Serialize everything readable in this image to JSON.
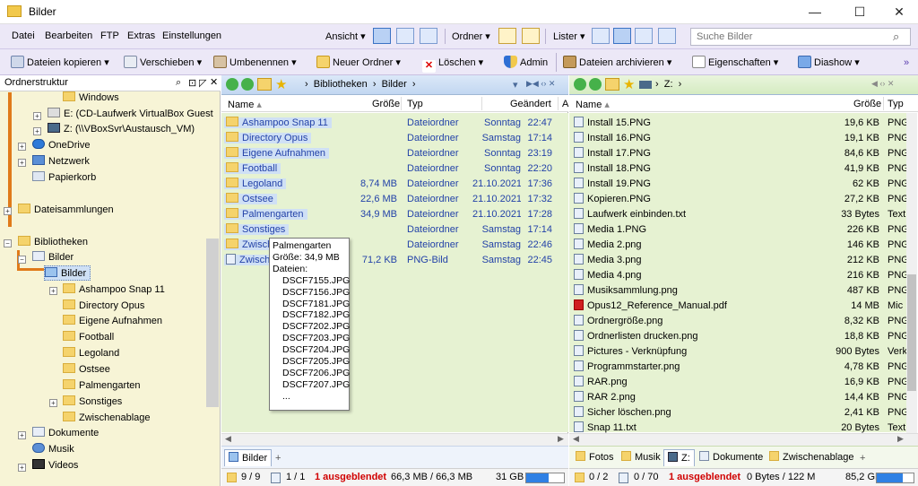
{
  "window": {
    "title": "Bilder",
    "min": "—",
    "max": "☐",
    "close": "✕"
  },
  "menu": [
    "Datei",
    "Bearbeiten",
    "FTP",
    "Extras",
    "Einstellungen"
  ],
  "menu_right": {
    "ansicht": "Ansicht",
    "ordner": "Ordner",
    "lister": "Lister"
  },
  "search": {
    "placeholder": "Suche Bilder"
  },
  "toolbar": {
    "copy": "Dateien kopieren",
    "move": "Verschieben",
    "rename": "Umbenennen",
    "newfolder": "Neuer Ordner",
    "delete": "Löschen",
    "admin": "Admin",
    "archive": "Dateien archivieren",
    "props": "Eigenschaften",
    "slideshow": "Diashow"
  },
  "tree": {
    "header": "Ordnerstruktur",
    "items": [
      {
        "label": "Windows"
      },
      {
        "label": "E: (CD-Laufwerk VirtualBox Guest"
      },
      {
        "label": "Z: (\\\\VBoxSvr\\Austausch_VM)"
      },
      {
        "label": "OneDrive"
      },
      {
        "label": "Netzwerk"
      },
      {
        "label": "Papierkorb"
      },
      {
        "label": "Dateisammlungen"
      },
      {
        "label": "Bibliotheken"
      },
      {
        "label": "Bilder"
      },
      {
        "label": "Bilder"
      },
      {
        "label": "Ashampoo Snap 11"
      },
      {
        "label": "Directory Opus"
      },
      {
        "label": "Eigene Aufnahmen"
      },
      {
        "label": "Football"
      },
      {
        "label": "Legoland"
      },
      {
        "label": "Ostsee"
      },
      {
        "label": "Palmengarten"
      },
      {
        "label": "Sonstiges"
      },
      {
        "label": "Zwischenablage"
      },
      {
        "label": "Dokumente"
      },
      {
        "label": "Musik"
      },
      {
        "label": "Videos"
      }
    ]
  },
  "left": {
    "path": [
      "Bibliotheken",
      "Bilder"
    ],
    "columns": {
      "name": "Name",
      "size": "Größe",
      "type": "Typ",
      "changed": "Geändert",
      "extra": "A"
    },
    "rows": [
      {
        "name": "Ashampoo Snap 11",
        "size": "",
        "type": "Dateiordner",
        "date": "Sonntag",
        "time": "22:47"
      },
      {
        "name": "Directory Opus",
        "size": "",
        "type": "Dateiordner",
        "date": "Samstag",
        "time": "17:14"
      },
      {
        "name": "Eigene Aufnahmen",
        "size": "",
        "type": "Dateiordner",
        "date": "Sonntag",
        "time": "23:19"
      },
      {
        "name": "Football",
        "size": "",
        "type": "Dateiordner",
        "date": "Sonntag",
        "time": "22:20"
      },
      {
        "name": "Legoland",
        "size": "8,74 MB",
        "type": "Dateiordner",
        "date": "21.10.2021",
        "time": "17:36"
      },
      {
        "name": "Ostsee",
        "size": "22,6 MB",
        "type": "Dateiordner",
        "date": "21.10.2021",
        "time": "17:32"
      },
      {
        "name": "Palmengarten",
        "size": "34,9 MB",
        "type": "Dateiordner",
        "date": "21.10.2021",
        "time": "17:28"
      },
      {
        "name": "Sonstiges",
        "size": "",
        "type": "Dateiordner",
        "date": "Samstag",
        "time": "17:14"
      },
      {
        "name": "Zwisch",
        "size": "",
        "type": "Dateiordner",
        "date": "Samstag",
        "time": "22:46"
      },
      {
        "name": "Zwisch",
        "size": "71,2 KB",
        "type": "PNG-Bild",
        "date": "Samstag",
        "time": "22:45"
      }
    ],
    "tab": "Bilder",
    "status": {
      "dirs": "9 / 9",
      "files": "1 / 1",
      "hidden": "1 ausgeblendet",
      "size": "66,3 MB / 66,3 MB",
      "free": "31 GB"
    }
  },
  "tooltip": {
    "title": "Palmengarten",
    "size": "Größe: 34,9 MB",
    "files_label": "Dateien:",
    "files": [
      "DSCF7155.JPG",
      "DSCF7156.JPG",
      "DSCF7181.JPG",
      "DSCF7182.JPG",
      "DSCF7202.JPG",
      "DSCF7203.JPG",
      "DSCF7204.JPG",
      "DSCF7205.JPG",
      "DSCF7206.JPG",
      "DSCF7207.JPG",
      "..."
    ]
  },
  "right": {
    "path": [
      "Z:"
    ],
    "columns": {
      "name": "Name",
      "size": "Größe",
      "type": "Typ"
    },
    "rows": [
      {
        "name": "Install 15.PNG",
        "size": "19,6 KB",
        "type": "PNG"
      },
      {
        "name": "Install 16.PNG",
        "size": "19,1 KB",
        "type": "PNG"
      },
      {
        "name": "Install 17.PNG",
        "size": "84,6 KB",
        "type": "PNG"
      },
      {
        "name": "Install 18.PNG",
        "size": "41,9 KB",
        "type": "PNG"
      },
      {
        "name": "Install 19.PNG",
        "size": "62 KB",
        "type": "PNG"
      },
      {
        "name": "Kopieren.PNG",
        "size": "27,2 KB",
        "type": "PNG"
      },
      {
        "name": "Laufwerk einbinden.txt",
        "size": "33 Bytes",
        "type": "Text"
      },
      {
        "name": "Media 1.PNG",
        "size": "226 KB",
        "type": "PNG"
      },
      {
        "name": "Media 2.png",
        "size": "146 KB",
        "type": "PNG"
      },
      {
        "name": "Media 3.png",
        "size": "212 KB",
        "type": "PNG"
      },
      {
        "name": "Media 4.png",
        "size": "216 KB",
        "type": "PNG"
      },
      {
        "name": "Musiksammlung.png",
        "size": "487 KB",
        "type": "PNG"
      },
      {
        "name": "Opus12_Reference_Manual.pdf",
        "size": "14 MB",
        "type": "Mic"
      },
      {
        "name": "Ordnergröße.png",
        "size": "8,32 KB",
        "type": "PNG"
      },
      {
        "name": "Ordnerlisten drucken.png",
        "size": "18,8 KB",
        "type": "PNG"
      },
      {
        "name": "Pictures - Verknüpfung",
        "size": "900 Bytes",
        "type": "Verk"
      },
      {
        "name": "Programmstarter.png",
        "size": "4,78 KB",
        "type": "PNG"
      },
      {
        "name": "RAR.png",
        "size": "16,9 KB",
        "type": "PNG"
      },
      {
        "name": "RAR 2.png",
        "size": "14,4 KB",
        "type": "PNG"
      },
      {
        "name": "Sicher löschen.png",
        "size": "2,41 KB",
        "type": "PNG"
      },
      {
        "name": "Snap 11.txt",
        "size": "20 Bytes",
        "type": "Text"
      }
    ],
    "tabs": [
      "Fotos",
      "Musik",
      "Z:",
      "Dokumente",
      "Zwischenablage"
    ],
    "status": {
      "dirs": "0 / 2",
      "files": "0 / 70",
      "hidden": "1 ausgeblendet",
      "size": "0 Bytes / 122 M",
      "free": "85,2 GB"
    }
  },
  "colors": {
    "accent": "#2342a8",
    "tree_bg": "#f7f4d6",
    "pane_bg": "#e6f2d2",
    "menu_bg": "#ece8f7",
    "hidden_red": "#d00000"
  }
}
